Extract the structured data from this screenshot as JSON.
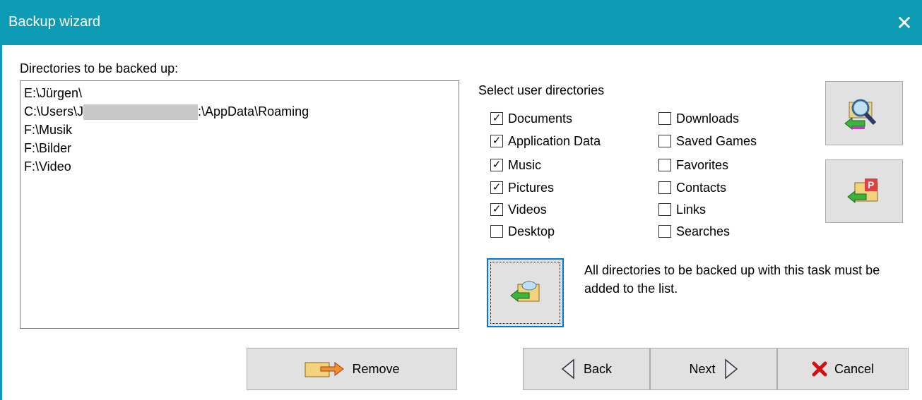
{
  "window": {
    "title": "Backup wizard",
    "close_glyph": "✕"
  },
  "directories": {
    "label": "Directories to be backed up:",
    "items": [
      "E:\\Jürgen\\",
      "F:\\Musik",
      "F:\\Bilder",
      "F:\\Video"
    ],
    "partial_item": {
      "prefix": "C:\\Users\\J",
      "suffix": ":\\AppData\\Roaming"
    }
  },
  "user_dirs": {
    "label": "Select user directories",
    "left": [
      {
        "label": "Documents",
        "checked": true
      },
      {
        "label": "Application Data",
        "checked": true
      },
      {
        "label": "Music",
        "checked": true
      },
      {
        "label": "Pictures",
        "checked": true
      },
      {
        "label": "Videos",
        "checked": true
      },
      {
        "label": "Desktop",
        "checked": false
      }
    ],
    "right": [
      {
        "label": "Downloads",
        "checked": false
      },
      {
        "label": "Saved Games",
        "checked": false
      },
      {
        "label": "Favorites",
        "checked": false
      },
      {
        "label": "Contacts",
        "checked": false
      },
      {
        "label": "Links",
        "checked": false
      },
      {
        "label": "Searches",
        "checked": false
      }
    ]
  },
  "note": "All directories to be backed up with this task must be added to the list.",
  "buttons": {
    "remove": "Remove",
    "back": "Back",
    "next": "Next",
    "cancel": "Cancel"
  },
  "icons": {
    "browse": "folder-search-add-icon",
    "special": "special-folder-add-icon",
    "add": "folder-add-icon",
    "remove": "folder-remove-icon",
    "back": "triangle-left-icon",
    "next": "triangle-right-icon",
    "cancel": "red-x-icon"
  },
  "colors": {
    "titlebar": "#0e9bb6",
    "focus_border": "#0078d7",
    "button_face": "#e1e1e1"
  }
}
